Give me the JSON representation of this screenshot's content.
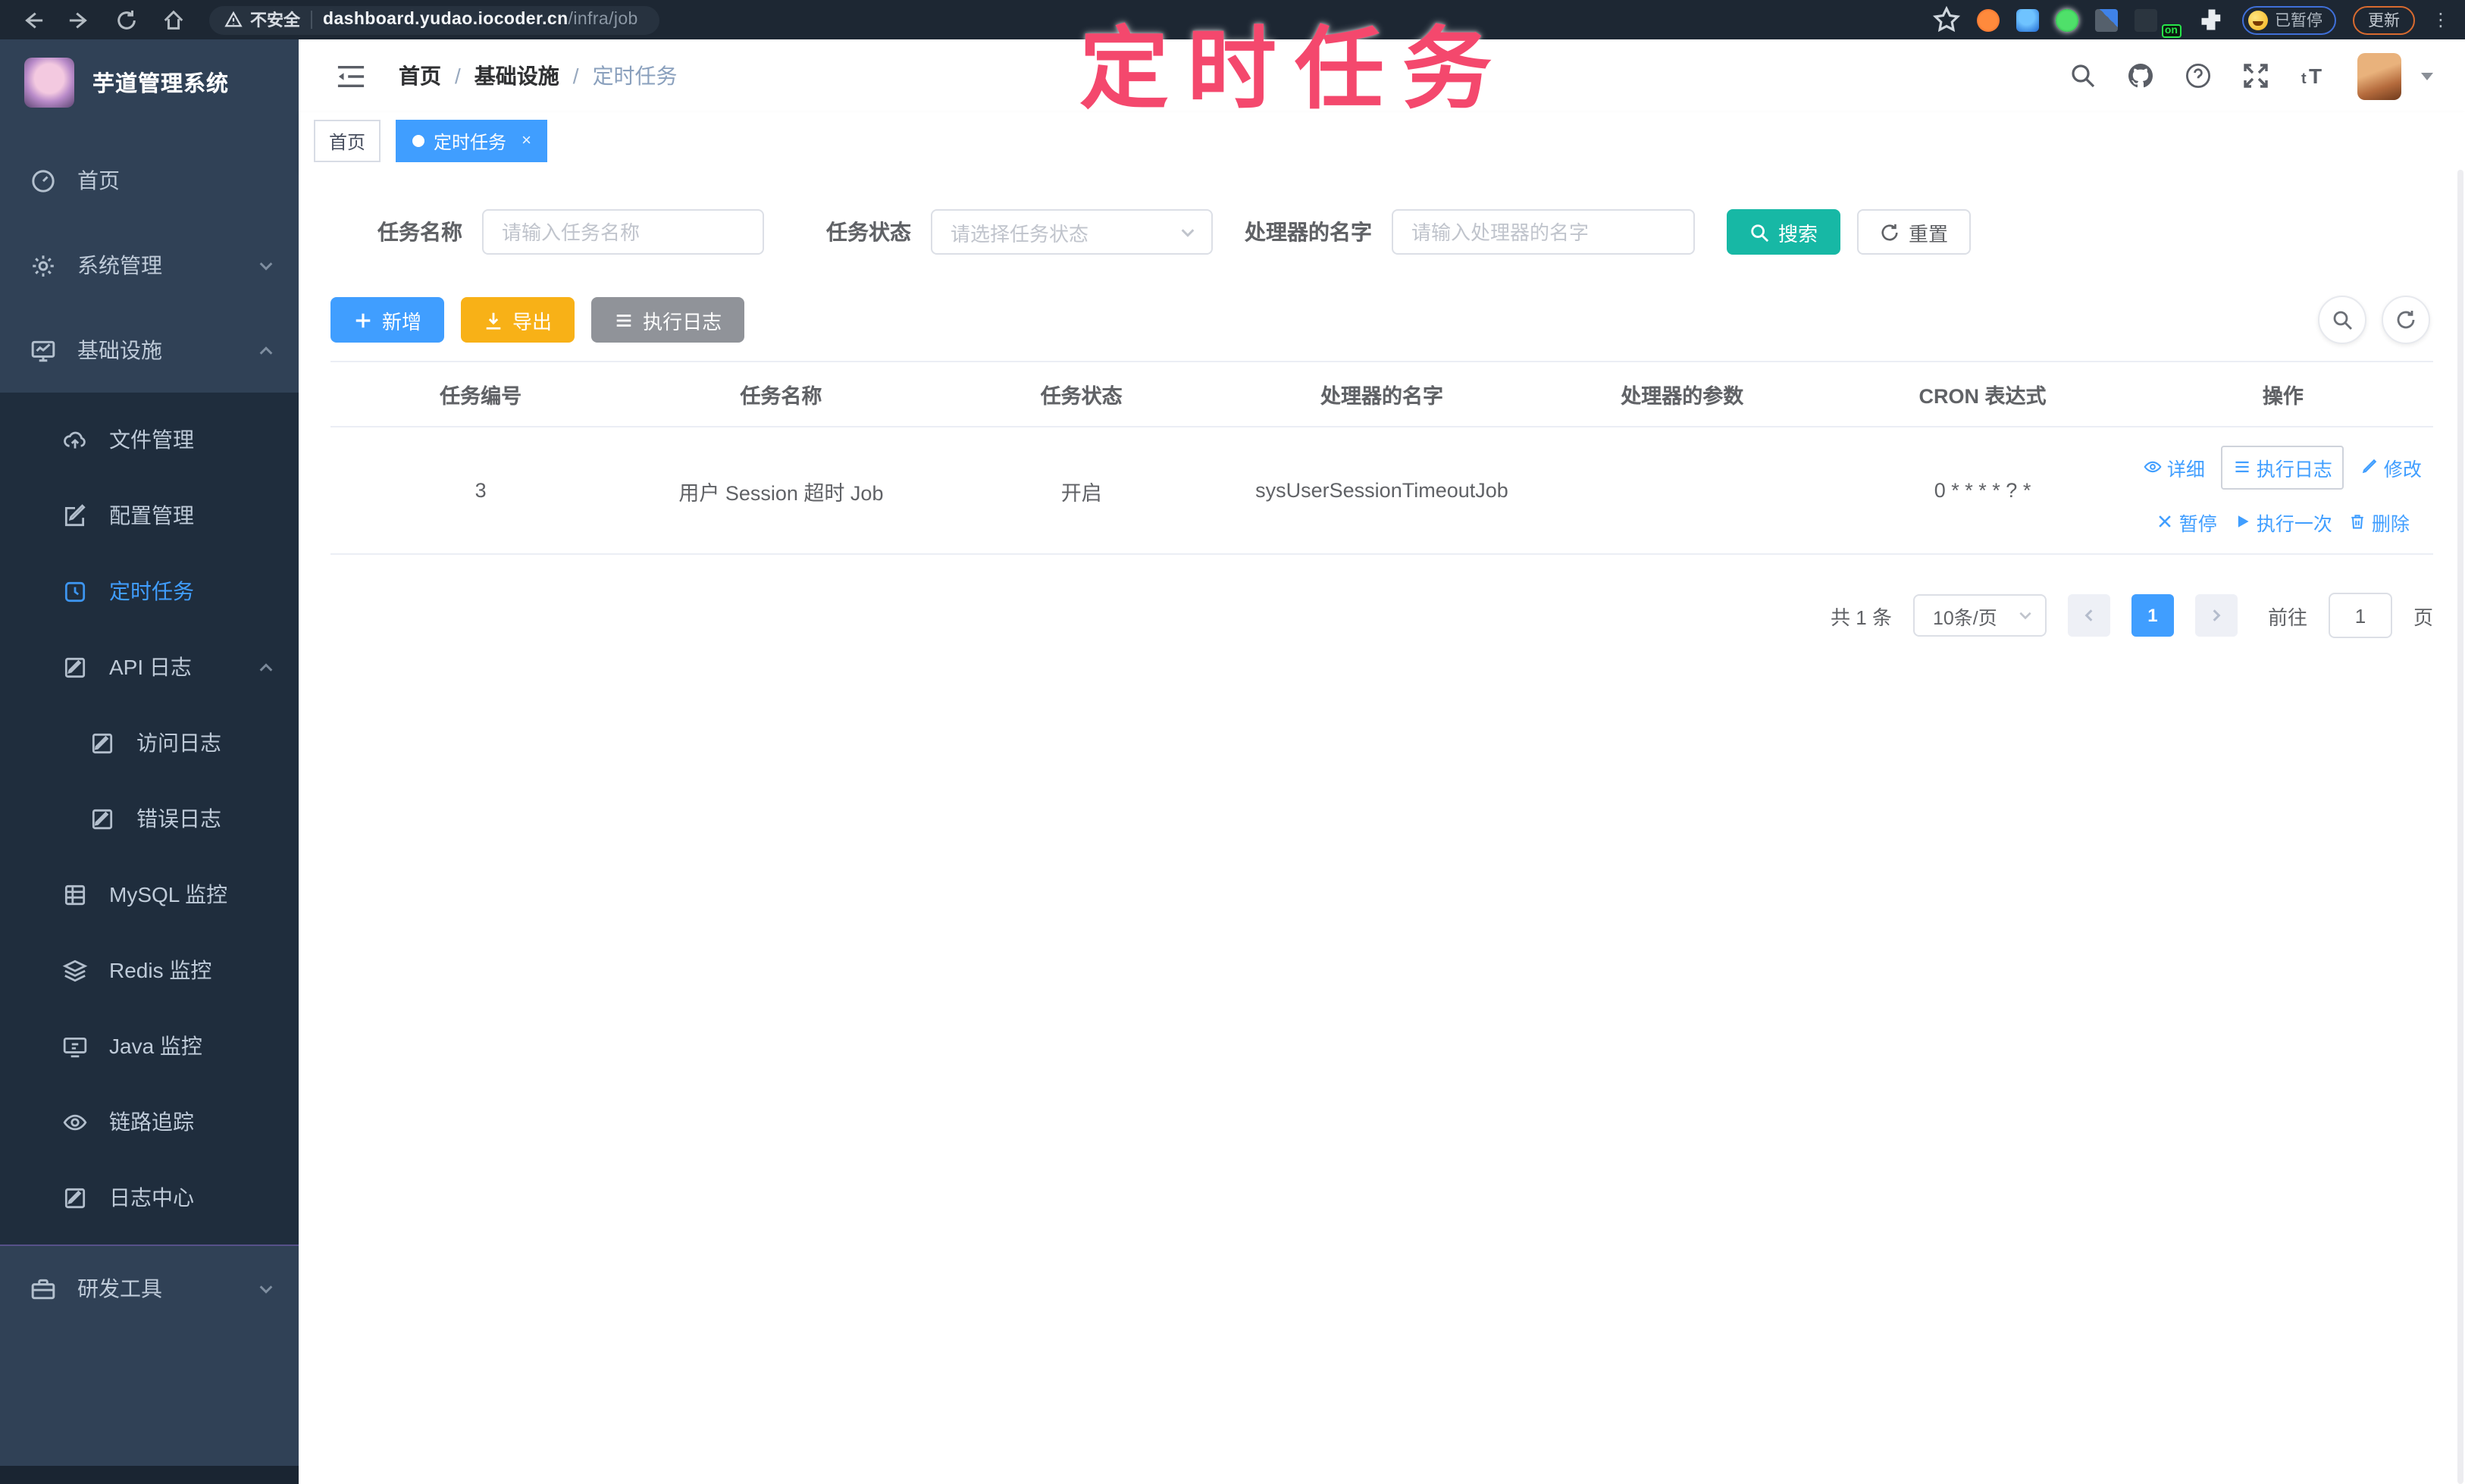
{
  "browser": {
    "security_label": "不安全",
    "url_host": "dashboard.yudao.iocoder.cn",
    "url_path": "/infra/job",
    "extension_badge": "on",
    "profile_label": "已暂停",
    "update_label": "更新"
  },
  "annotation": {
    "title": "定时任务",
    "color": "#f4486d"
  },
  "sidebar": {
    "app_title": "芋道管理系统",
    "items": [
      {
        "label": "首页"
      },
      {
        "label": "系统管理"
      },
      {
        "label": "基础设施"
      },
      {
        "label": "文件管理"
      },
      {
        "label": "配置管理"
      },
      {
        "label": "定时任务"
      },
      {
        "label": "API 日志"
      },
      {
        "label": "访问日志"
      },
      {
        "label": "错误日志"
      },
      {
        "label": "MySQL 监控"
      },
      {
        "label": "Redis 监控"
      },
      {
        "label": "Java 监控"
      },
      {
        "label": "链路追踪"
      },
      {
        "label": "日志中心"
      },
      {
        "label": "研发工具"
      }
    ]
  },
  "header": {
    "breadcrumb": [
      "首页",
      "基础设施",
      "定时任务"
    ],
    "separator": "/"
  },
  "tabs": [
    {
      "label": "首页"
    },
    {
      "label": "定时任务",
      "close": "×"
    }
  ],
  "filters": {
    "job_name_label": "任务名称",
    "job_name_placeholder": "请输入任务名称",
    "job_status_label": "任务状态",
    "job_status_placeholder": "请选择任务状态",
    "handler_label": "处理器的名字",
    "handler_placeholder": "请输入处理器的名字",
    "search_label": "搜索",
    "reset_label": "重置"
  },
  "toolbar": {
    "add_label": "新增",
    "export_label": "导出",
    "exec_log_label": "执行日志"
  },
  "table": {
    "columns": [
      "任务编号",
      "任务名称",
      "任务状态",
      "处理器的名字",
      "处理器的参数",
      "CRON 表达式",
      "操作"
    ],
    "rows": [
      {
        "id": "3",
        "name": "用户 Session 超时 Job",
        "status": "开启",
        "handler": "sysUserSessionTimeoutJob",
        "params": "",
        "cron": "0 * * * * ? *"
      }
    ],
    "actions": {
      "detail": "详细",
      "exec_log": "执行日志",
      "edit": "修改",
      "pause": "暂停",
      "run_once": "执行一次",
      "delete": "删除"
    }
  },
  "pagination": {
    "total": "共 1 条",
    "page_size": "10条/页",
    "current_page": "1",
    "goto_label": "前往",
    "goto_value": "1",
    "page_suffix": "页"
  },
  "colors": {
    "accent": "#409eff",
    "search": "#17b8a5",
    "export": "#f8b117",
    "info": "#909399"
  }
}
